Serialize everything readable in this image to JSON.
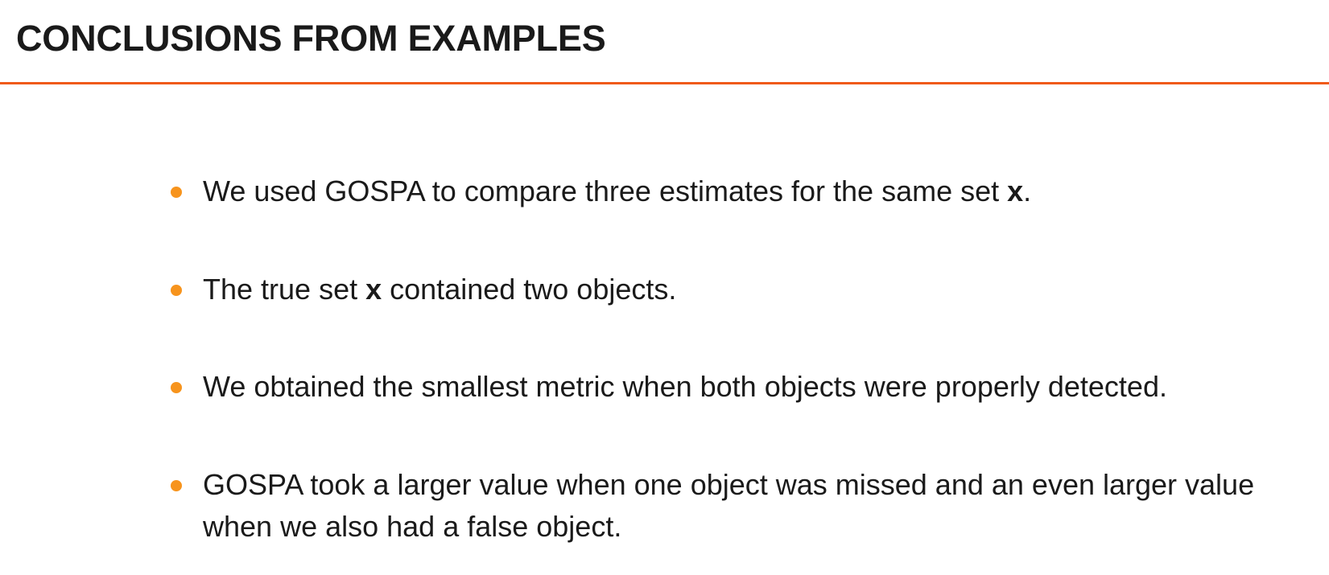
{
  "colors": {
    "accent": "#f05a1a",
    "bullet": "#f7941d",
    "text": "#1a1a1a"
  },
  "header": {
    "title": "CONCLUSIONS FROM EXAMPLES"
  },
  "bullets": [
    {
      "parts": [
        "We used GOSPA to compare three estimates for the same set ",
        "x",
        "."
      ]
    },
    {
      "parts": [
        "The true set ",
        "x",
        " contained two objects."
      ]
    },
    {
      "parts": [
        "We obtained the smallest metric when both objects were properly detected."
      ]
    },
    {
      "parts": [
        "GOSPA took a larger value when one object was missed and an even larger value when we also had a false object."
      ]
    }
  ]
}
